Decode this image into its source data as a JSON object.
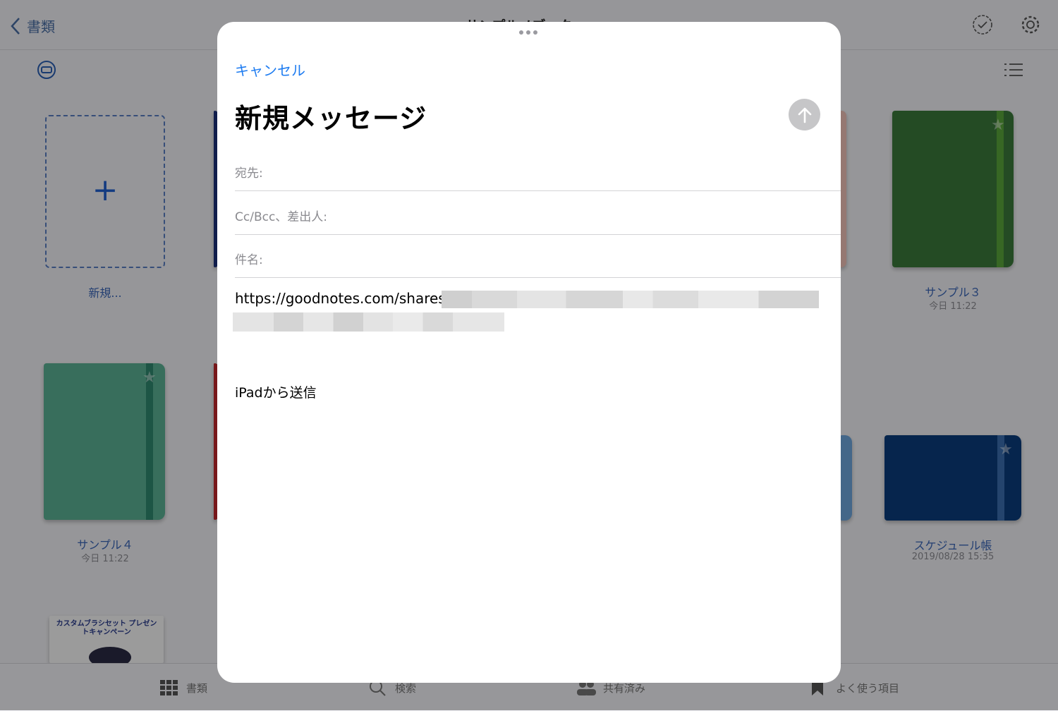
{
  "background": {
    "back_label": "書類",
    "title": "サンプルノブック",
    "new_tile_label": "新規...",
    "notebooks": [
      {
        "label": "サンプル３",
        "date": "今日 11:22",
        "color": "#3a7a3a"
      },
      {
        "label": "サンプル４",
        "date": "今日 11:22",
        "color": "#5bb295"
      },
      {
        "label": "スケジュール帳",
        "date": "2019/08/28 15:35",
        "color": "#0b3d7d"
      }
    ],
    "promo_text": "カスタムブラシセット プレゼントキャンペーン",
    "tabs": [
      {
        "label": "書類",
        "icon": "grid-icon"
      },
      {
        "label": "検索",
        "icon": "search-icon"
      },
      {
        "label": "共有済み",
        "icon": "people-icon"
      },
      {
        "label": "よく使う項目",
        "icon": "bookmark-icon"
      }
    ]
  },
  "modal": {
    "cancel_label": "キャンセル",
    "title": "新規メッセージ",
    "send_icon": "arrow-up-icon",
    "fields": {
      "to_label": "宛先:",
      "cc_label": "Cc/Bcc、差出人:",
      "subject_label": "件名:"
    },
    "body_url": "https://goodnotes.com/shares/",
    "signature": "iPadから送信"
  },
  "colors": {
    "accent": "#1e7cf1",
    "send_disabled": "#c6c6c8"
  }
}
